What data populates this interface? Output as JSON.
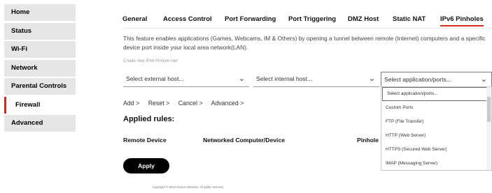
{
  "sidebar": {
    "items": [
      {
        "label": "Home"
      },
      {
        "label": "Status"
      },
      {
        "label": "Wi-Fi"
      },
      {
        "label": "Network"
      },
      {
        "label": "Parental Controls"
      },
      {
        "label": "Firewall"
      },
      {
        "label": "Advanced"
      }
    ],
    "active": "Firewall"
  },
  "tabs": [
    {
      "label": "General"
    },
    {
      "label": "Access Control"
    },
    {
      "label": "Port Forwarding"
    },
    {
      "label": "Port Triggering"
    },
    {
      "label": "DMZ Host"
    },
    {
      "label": "Static NAT"
    },
    {
      "label": "IPv6 Pinholes"
    }
  ],
  "active_tab": "IPv6 Pinholes",
  "description": "This feature enables applications (Games, Webcams, IM & Others) by opening a tunnel between remote (Internet) computers and a specific device port inside your local area network(LAN).",
  "create_label": "Create new IPv6 Pinhole rule",
  "selects": {
    "external": "Select external host...",
    "internal": "Select internal host...",
    "application": "Select application/ports..."
  },
  "dropdown_options": [
    "Select application/ports...",
    "Custom Ports",
    "FTP (File Transfer)",
    "HTTP (Web Server)",
    "HTTPS (Secured Web Server)",
    "IMAP (Messaging Server)"
  ],
  "actions": {
    "add": "Add >",
    "reset": "Reset >",
    "cancel": "Cancel >",
    "advanced": "Advanced >"
  },
  "applied_title": "Applied rules:",
  "columns": {
    "remote": "Remote Device",
    "networked": "Networked Computer/Device",
    "pinhole": "Pinhole"
  },
  "apply_label": "Apply",
  "footer": "Copyright © 2019 Verizon Wireless. All rights reserved."
}
